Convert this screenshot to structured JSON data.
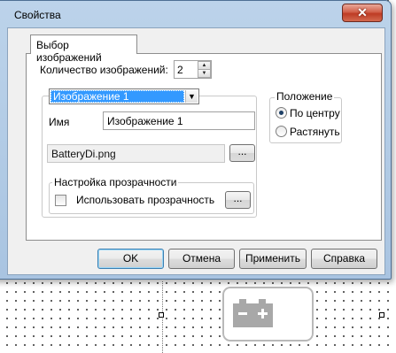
{
  "dialog": {
    "title": "Свойства",
    "close_glyph": "✕",
    "tab_label": "Выбор изображений",
    "count_label": "Количество изображений:",
    "count_value": "2",
    "image_select_value": "Изображение 1",
    "name_label": "Имя",
    "name_value": "Изображение 1",
    "file_value": "BatteryDi.png",
    "browse_label": "...",
    "transparency": {
      "group_title": "Настройка прозрачности",
      "checkbox_label": "Использовать прозрачность",
      "checked": false,
      "button_label": "..."
    },
    "position": {
      "group_title": "Положение",
      "options": [
        "По центру",
        "Растянуть"
      ],
      "selected": "По центру"
    },
    "buttons": {
      "ok": "OK",
      "cancel": "Отмена",
      "apply": "Применить",
      "help": "Справка"
    }
  },
  "canvas": {
    "widget_icon": "battery-icon"
  },
  "colors": {
    "selection": "#3399ff",
    "close_button": "#c8452d",
    "window_frame": "#b4cce6"
  }
}
